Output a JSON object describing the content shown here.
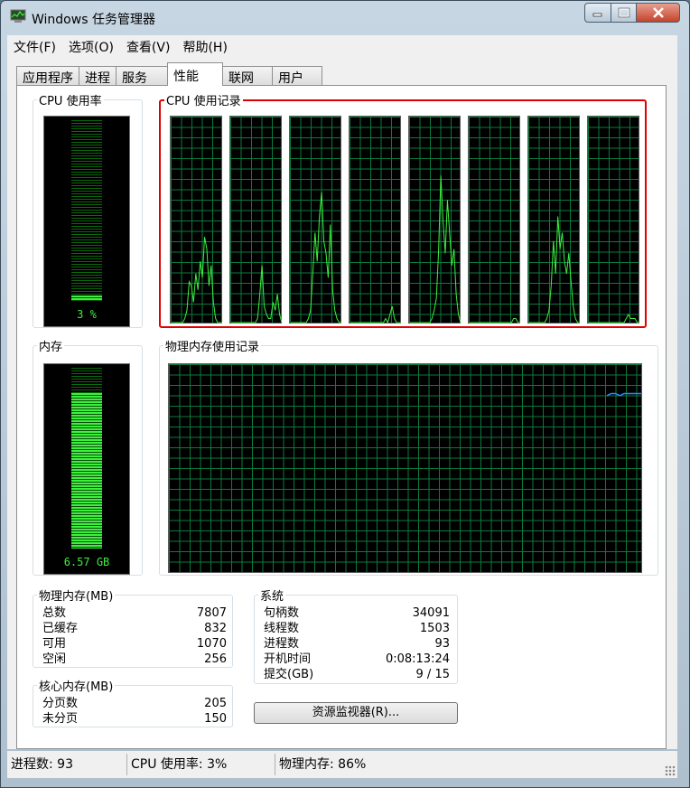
{
  "window": {
    "title": "Windows 任务管理器"
  },
  "menu": [
    "文件(F)",
    "选项(O)",
    "查看(V)",
    "帮助(H)"
  ],
  "tabs": [
    {
      "label": "应用程序",
      "active": false
    },
    {
      "label": "进程",
      "active": false
    },
    {
      "label": "服务",
      "active": false
    },
    {
      "label": "性能",
      "active": true
    },
    {
      "label": "联网",
      "active": false
    },
    {
      "label": "用户",
      "active": false
    }
  ],
  "cpu_usage": {
    "title": "CPU 使用率",
    "value_label": "3 %",
    "level": 0.03
  },
  "cpu_history": {
    "title": "CPU 使用记录",
    "cores": [
      [
        0,
        0,
        0,
        0,
        0,
        0,
        2,
        6,
        20,
        18,
        10,
        24,
        16,
        30,
        22,
        42,
        36,
        18,
        28,
        10,
        2,
        0,
        0,
        0
      ],
      [
        0,
        0,
        0,
        0,
        0,
        0,
        0,
        0,
        0,
        0,
        0,
        0,
        2,
        14,
        28,
        8,
        4,
        2,
        2,
        10,
        6,
        14,
        4,
        0
      ],
      [
        0,
        0,
        0,
        0,
        0,
        0,
        0,
        0,
        2,
        6,
        24,
        44,
        30,
        52,
        64,
        40,
        34,
        22,
        48,
        16,
        6,
        2,
        0,
        0
      ],
      [
        0,
        0,
        0,
        0,
        0,
        0,
        0,
        0,
        0,
        0,
        0,
        0,
        0,
        0,
        0,
        0,
        2,
        0,
        4,
        8,
        2,
        0,
        0,
        0
      ],
      [
        0,
        0,
        0,
        0,
        0,
        0,
        0,
        0,
        0,
        0,
        2,
        6,
        12,
        36,
        72,
        50,
        34,
        60,
        44,
        28,
        36,
        14,
        4,
        0
      ],
      [
        0,
        0,
        0,
        0,
        0,
        0,
        0,
        0,
        0,
        0,
        0,
        0,
        0,
        0,
        0,
        0,
        0,
        0,
        0,
        0,
        2,
        2,
        0,
        0
      ],
      [
        0,
        0,
        0,
        0,
        0,
        0,
        0,
        0,
        2,
        6,
        18,
        40,
        24,
        52,
        36,
        44,
        30,
        24,
        34,
        20,
        8,
        2,
        0,
        0
      ],
      [
        0,
        0,
        0,
        0,
        0,
        0,
        0,
        0,
        0,
        0,
        0,
        0,
        0,
        0,
        0,
        0,
        0,
        2,
        4,
        2,
        2,
        2,
        0,
        0
      ]
    ]
  },
  "memory": {
    "title": "内存",
    "value_label": "6.57 GB",
    "level": 0.86
  },
  "memory_history": {
    "title": "物理内存使用记录",
    "values": [
      85,
      86,
      86,
      85,
      86,
      86,
      86,
      86,
      86
    ]
  },
  "physical_memory": {
    "title": "物理内存(MB)",
    "rows": [
      {
        "label": "总数",
        "value": "7807"
      },
      {
        "label": "已缓存",
        "value": "832"
      },
      {
        "label": "可用",
        "value": "1070"
      },
      {
        "label": "空闲",
        "value": "256"
      }
    ]
  },
  "kernel_memory": {
    "title": "核心内存(MB)",
    "rows": [
      {
        "label": "分页数",
        "value": "205"
      },
      {
        "label": "未分页",
        "value": "150"
      }
    ]
  },
  "system": {
    "title": "系统",
    "rows": [
      {
        "label": "句柄数",
        "value": "34091"
      },
      {
        "label": "线程数",
        "value": "1503"
      },
      {
        "label": "进程数",
        "value": "93"
      },
      {
        "label": "开机时间",
        "value": "0:08:13:24"
      },
      {
        "label": "提交(GB)",
        "value": "9 / 15"
      }
    ]
  },
  "resource_monitor_button": "资源监视器(R)...",
  "status": {
    "processes": "进程数: 93",
    "cpu": "CPU 使用率: 3%",
    "memory": "物理内存: 86%"
  },
  "colors": {
    "graph_line": "#3ef03e",
    "graph_grid": "#0b7a3e",
    "memory_line": "#2a8bff",
    "highlight": "#e00000"
  }
}
